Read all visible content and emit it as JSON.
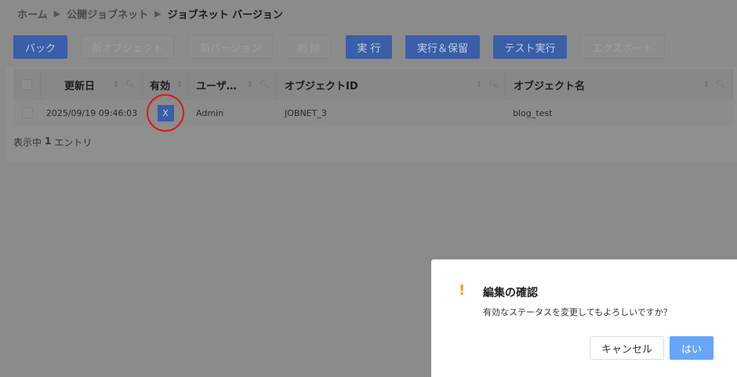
{
  "breadcrumb": [
    "ホーム",
    "公開ジョブネット",
    "ジョブネット バージョン"
  ],
  "toolbar": {
    "back": "バック",
    "new_object": "新オブジェクト",
    "new_version": "新バージョン",
    "delete": "削 除",
    "run": "実 行",
    "run_hold": "実行＆保留",
    "test_run": "テスト実行",
    "export": "エクスポート"
  },
  "table": {
    "headers": [
      "更新日",
      "有効",
      "ユーザ…",
      "オブジェクトID",
      "オブジェクト名"
    ],
    "rows": [
      {
        "updated": "2025/09/19 09:46:03",
        "valid": "X",
        "user": "Admin",
        "object_id": "JOBNET_3",
        "object_name": "blog_test"
      }
    ]
  },
  "footer": {
    "prefix": "表示中",
    "count": "1",
    "suffix": "エントリ"
  },
  "dialog": {
    "title": "編集の確認",
    "message": "有効なステータスを変更してもよろしいですか？",
    "cancel": "キャンセル",
    "ok": "はい",
    "accent": "#f0a020"
  }
}
